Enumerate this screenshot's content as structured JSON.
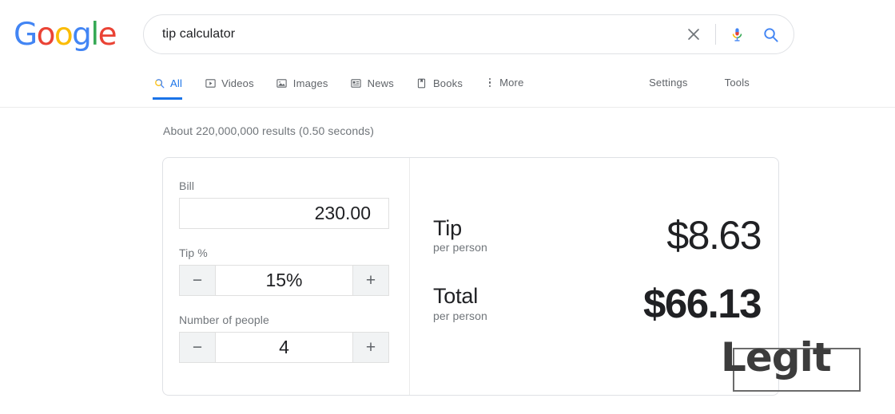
{
  "header": {
    "logo": {
      "name": "google-logo",
      "letters": [
        {
          "char": "G",
          "color": "#4285F4"
        },
        {
          "char": "o",
          "color": "#EA4335"
        },
        {
          "char": "o",
          "color": "#FBBC05"
        },
        {
          "char": "g",
          "color": "#4285F4"
        },
        {
          "char": "l",
          "color": "#34A853"
        },
        {
          "char": "e",
          "color": "#EA4335"
        }
      ]
    },
    "search": {
      "query": "tip calculator",
      "placeholder": "Search",
      "clear_icon": "close-icon",
      "mic_icon": "microphone-icon",
      "search_icon": "search-icon"
    },
    "tabs": [
      {
        "label": "All",
        "icon": "search-icon",
        "active": true
      },
      {
        "label": "Videos",
        "icon": "video-icon",
        "active": false
      },
      {
        "label": "Images",
        "icon": "image-icon",
        "active": false
      },
      {
        "label": "News",
        "icon": "news-icon",
        "active": false
      },
      {
        "label": "Books",
        "icon": "book-icon",
        "active": false
      },
      {
        "label": "More",
        "icon": "more-vertical-icon",
        "active": false
      }
    ],
    "settings_label": "Settings",
    "tools_label": "Tools"
  },
  "results": {
    "stats": "About 220,000,000 results (0.50 seconds)"
  },
  "calculator": {
    "bill": {
      "label": "Bill",
      "value": "230.00"
    },
    "tip_percent": {
      "label": "Tip %",
      "value": "15%",
      "decrement": "−",
      "increment": "+"
    },
    "people": {
      "label": "Number of people",
      "value": "4",
      "decrement": "−",
      "increment": "+"
    },
    "output": {
      "tip": {
        "title": "Tip",
        "subtitle": "per person",
        "amount": "$8.63"
      },
      "total": {
        "title": "Total",
        "subtitle": "per person",
        "amount": "$66.13"
      }
    }
  },
  "watermark": {
    "text": "Legit"
  },
  "colors": {
    "accent": "#1a73e8",
    "muted_text": "#70757a",
    "primary_text": "#202124",
    "border": "#dfe1e5"
  }
}
